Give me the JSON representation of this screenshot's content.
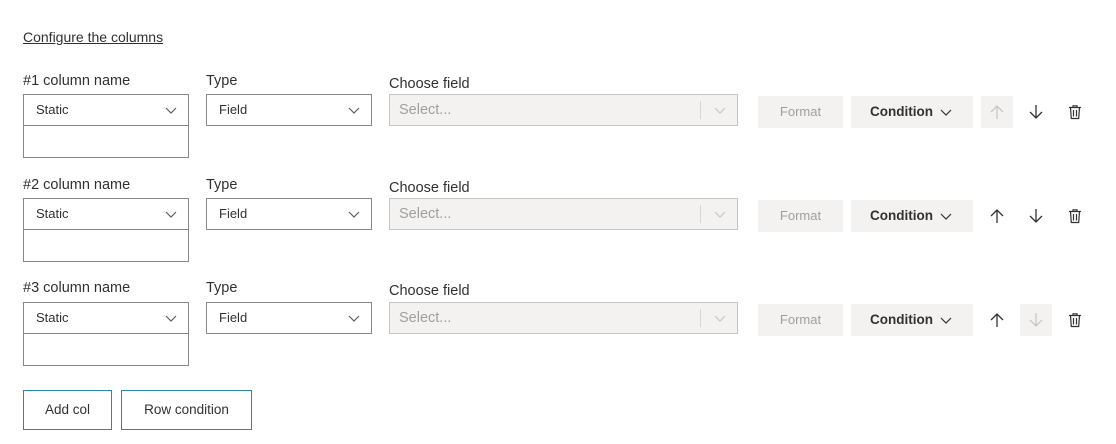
{
  "header": {
    "configure_link": "Configure the columns"
  },
  "columns": [
    {
      "name_label": "#1 column name",
      "name_mode": "Static",
      "name_value": "",
      "type_label": "Type",
      "type_value": "Field",
      "field_label": "Choose field",
      "field_placeholder": "Select...",
      "format_label": "Format",
      "condition_label": "Condition",
      "move_up_enabled": false,
      "move_down_enabled": true
    },
    {
      "name_label": "#2 column name",
      "name_mode": "Static",
      "name_value": "",
      "type_label": "Type",
      "type_value": "Field",
      "field_label": "Choose field",
      "field_placeholder": "Select...",
      "format_label": "Format",
      "condition_label": "Condition",
      "move_up_enabled": true,
      "move_down_enabled": true
    },
    {
      "name_label": "#3 column name",
      "name_mode": "Static",
      "name_value": "",
      "type_label": "Type",
      "type_value": "Field",
      "field_label": "Choose field",
      "field_placeholder": "Select...",
      "format_label": "Format",
      "condition_label": "Condition",
      "move_up_enabled": true,
      "move_down_enabled": false
    }
  ],
  "icons": {
    "move_up": "arrow-up-icon",
    "move_down": "arrow-down-icon",
    "delete": "trash-icon",
    "dropdown": "chevron-down-icon"
  },
  "footer": {
    "add_col_label": "Add col",
    "row_condition_label": "Row condition"
  },
  "colors": {
    "accent_border": "#2b88a8",
    "disabled_bg": "#f3f2f1",
    "disabled_text": "#a19f9d",
    "text": "#323130"
  }
}
